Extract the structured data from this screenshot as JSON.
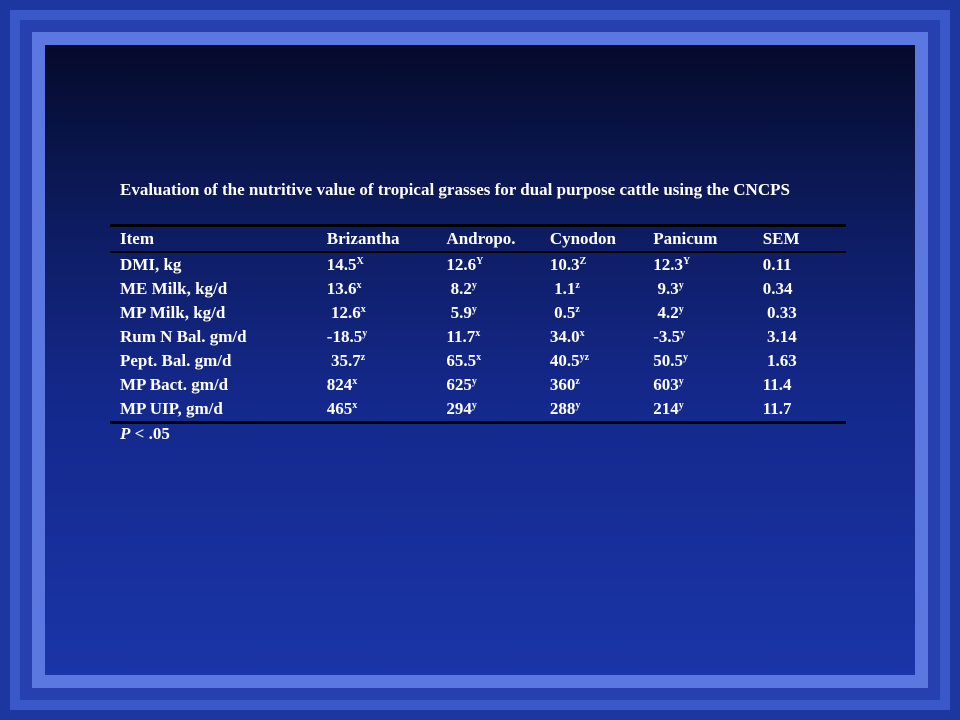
{
  "slide": {
    "title": "Evaluation of the nutritive value of tropical grasses for dual purpose cattle using the CNCPS",
    "note_italic": "P",
    "note_rest": " < .05"
  },
  "table": {
    "headers": [
      "Item",
      "Brizantha",
      "Andropo.",
      "Cynodon",
      "Panicum",
      "SEM"
    ],
    "rows": [
      {
        "item": "DMI, kg",
        "cells": [
          {
            "v": "14.5",
            "s": "X"
          },
          {
            "v": "12.6",
            "s": "Y"
          },
          {
            "v": "10.3",
            "s": "Z"
          },
          {
            "v": "12.3",
            "s": "Y"
          }
        ],
        "sem": "0.11"
      },
      {
        "item": "ME Milk, kg/d",
        "cells": [
          {
            "v": "13.6",
            "s": "x"
          },
          {
            "v": " 8.2",
            "s": "y"
          },
          {
            "v": " 1.1",
            "s": "z"
          },
          {
            "v": " 9.3",
            "s": "y"
          }
        ],
        "sem": "0.34"
      },
      {
        "item": "MP Milk, kg/d",
        "cells": [
          {
            "v": " 12.6",
            "s": "x"
          },
          {
            "v": " 5.9",
            "s": "y"
          },
          {
            "v": " 0.5",
            "s": "z"
          },
          {
            "v": " 4.2",
            "s": "y"
          }
        ],
        "sem": " 0.33"
      },
      {
        "item": "Rum N Bal. gm/d",
        "cells": [
          {
            "v": "-18.5",
            "s": "y"
          },
          {
            "v": "11.7",
            "s": "x"
          },
          {
            "v": "34.0",
            "s": "x"
          },
          {
            "v": "-3.5",
            "s": "y"
          }
        ],
        "sem": " 3.14"
      },
      {
        "item": "Pept. Bal. gm/d",
        "cells": [
          {
            "v": " 35.7",
            "s": "z"
          },
          {
            "v": "65.5",
            "s": "x"
          },
          {
            "v": "40.5",
            "s": "yz"
          },
          {
            "v": "50.5",
            "s": "y"
          }
        ],
        "sem": " 1.63"
      },
      {
        "item": "MP Bact. gm/d",
        "cells": [
          {
            "v": "824",
            "s": "x"
          },
          {
            "v": "625",
            "s": "y"
          },
          {
            "v": "360",
            "s": "z"
          },
          {
            "v": "603",
            "s": "y"
          }
        ],
        "sem": "11.4"
      },
      {
        "item": "MP UIP, gm/d",
        "cells": [
          {
            "v": "465",
            "s": "x"
          },
          {
            "v": "294",
            "s": "y"
          },
          {
            "v": "288",
            "s": "y"
          },
          {
            "v": "214",
            "s": "y"
          }
        ],
        "sem": "11.7"
      }
    ]
  }
}
